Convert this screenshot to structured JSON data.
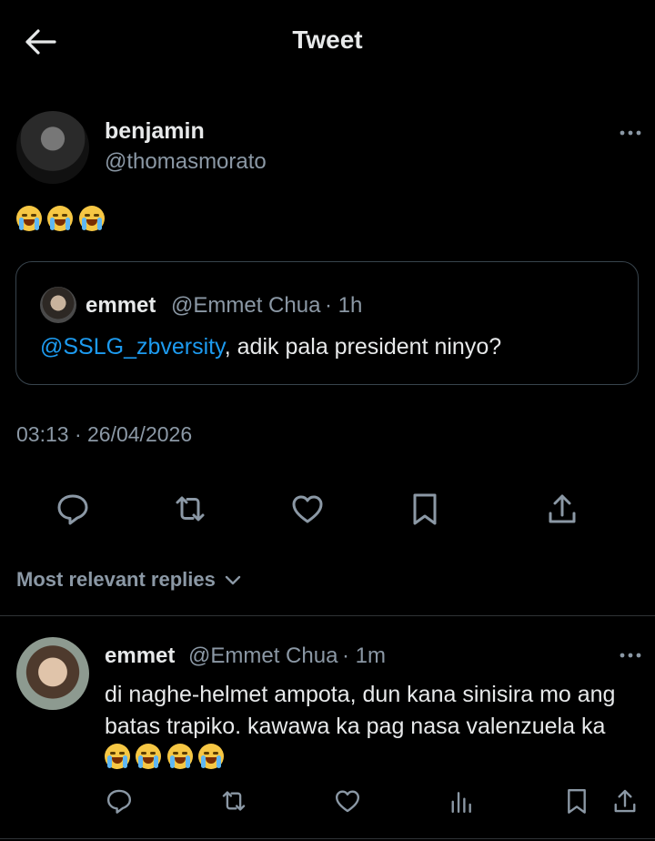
{
  "header": {
    "title": "Tweet"
  },
  "tweet": {
    "author_name": "benjamin",
    "author_handle": "@thomasmorato",
    "emoji_text": "😭😭😭",
    "timestamp": "03:13 · 26/04/2026"
  },
  "quote": {
    "author_name": "emmet",
    "author_handle": "@Emmet Chua",
    "time": "· 1h",
    "mention": "@SSLG_zbversity",
    "text": ", adik pala president ninyo?"
  },
  "replies_sort": {
    "label": "Most relevant replies"
  },
  "reply": {
    "author_name": "emmet",
    "author_handle": "@Emmet Chua",
    "time": "· 1m",
    "text": "di naghe-helmet ampota, dun kana sinisira mo ang batas trapiko. kawawa ka pag nasa valenzuela ka",
    "emoji_text": "🤣🤣🤣🤣"
  },
  "icons": {
    "back": "arrow-left-icon",
    "more": "more-icon",
    "reply": "reply-icon",
    "retweet": "retweet-icon",
    "like": "heart-icon",
    "bookmark": "bookmark-icon",
    "share": "share-icon",
    "analytics": "analytics-icon"
  },
  "colors": {
    "background": "#000000",
    "text": "#e7e9ea",
    "muted": "#8b98a5",
    "link": "#1d9bf0",
    "border": "#2f3336"
  }
}
